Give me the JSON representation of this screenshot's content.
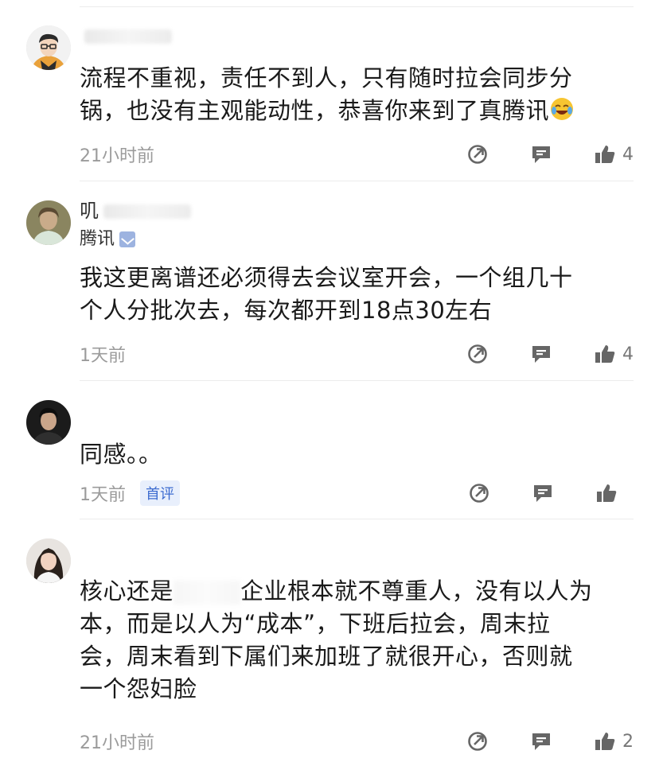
{
  "comments": [
    {
      "name": "",
      "company": "",
      "text_lines": [
        "流程不重视，责任不到人，只有随时拉会同步分",
        "锅，也没有主观能动性，恭喜你来到了真腾讯"
      ],
      "time": "21小时前",
      "likes": "4",
      "tag": ""
    },
    {
      "name": "叽",
      "company": "腾讯",
      "text_lines": [
        "我这更离谱还必须得去会议室开会，一个组几十",
        "个人分批次去，每次都开到18点30左右"
      ],
      "time": "1天前",
      "likes": "4",
      "tag": ""
    },
    {
      "name": "",
      "company": "",
      "text_lines": [
        "同感。。"
      ],
      "time": "1天前",
      "likes": "",
      "tag": "首评"
    },
    {
      "name": "",
      "company": "",
      "text_lines": [
        "核心还是",
        "企业根本就不尊重人，没有以人为",
        "本，而是以人为“成本”，下班后拉会，周末拉",
        "会，周末看到下属们来加班了就很开心，否则就",
        "一个怨妇脸"
      ],
      "time": "21小时前",
      "likes": "2",
      "tag": ""
    }
  ],
  "icons": {
    "share": "share-arrow-icon",
    "reply": "comment-bubble-icon",
    "like": "thumbs-up-icon",
    "emoji": "laughing-crying-emoji-icon",
    "verify": "verified-badge-icon"
  },
  "colors": {
    "time": "#9b9b9b",
    "icon": "#666666",
    "tag_text": "#3d6cd0",
    "tag_bg": "#e8effc"
  }
}
